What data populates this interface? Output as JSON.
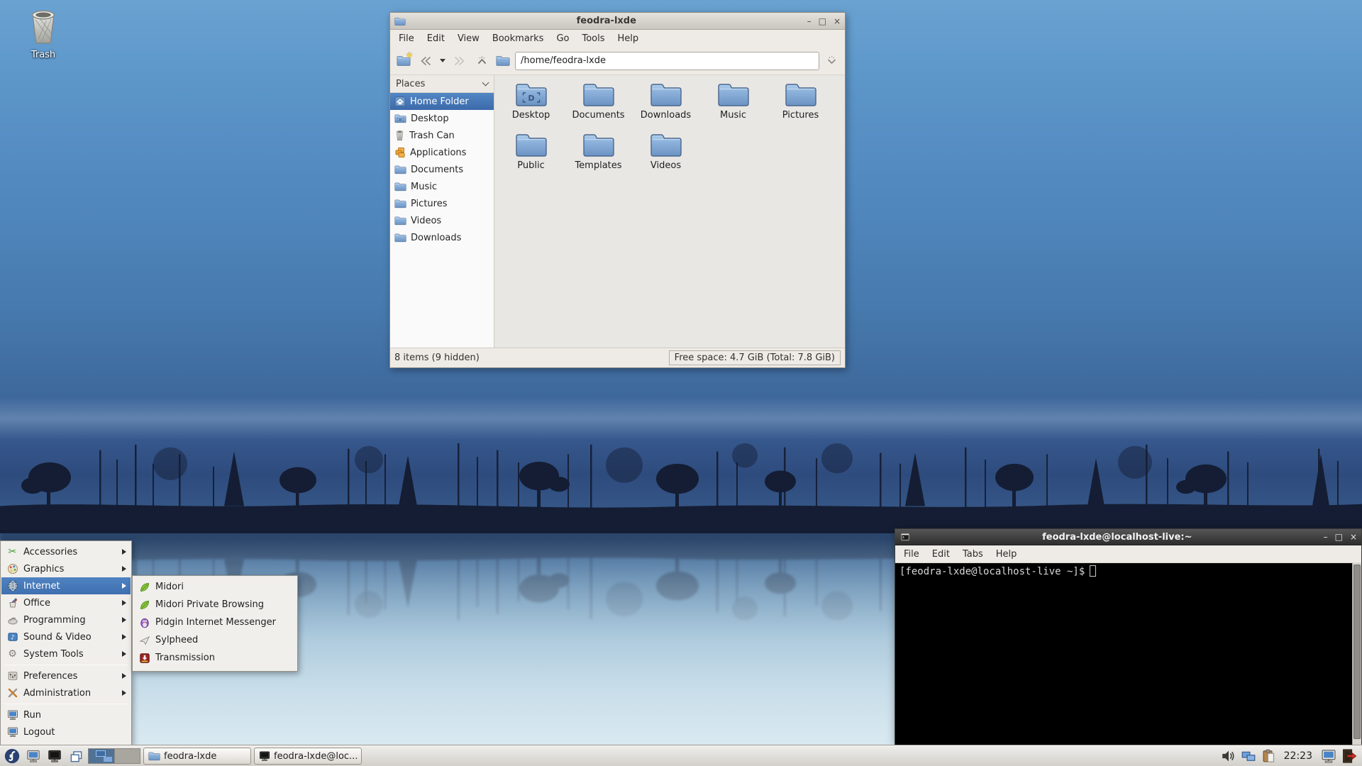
{
  "window_controls": {
    "minimize": "–",
    "maximize": "□",
    "close": "×"
  },
  "desktop": {
    "trash_label": "Trash"
  },
  "file_manager": {
    "title": "feodra-lxde",
    "menu_items": [
      "File",
      "Edit",
      "View",
      "Bookmarks",
      "Go",
      "Tools",
      "Help"
    ],
    "path": "/home/feodra-lxde",
    "places_header": "Places",
    "places": [
      {
        "label": "Home Folder",
        "icon": "home-icon",
        "selected": true
      },
      {
        "label": "Desktop",
        "icon": "desktop-folder-icon"
      },
      {
        "label": "Trash Can",
        "icon": "trash-icon"
      },
      {
        "label": "Applications",
        "icon": "applications-icon"
      },
      {
        "label": "Documents",
        "icon": "folder-icon"
      },
      {
        "label": "Music",
        "icon": "folder-icon"
      },
      {
        "label": "Pictures",
        "icon": "folder-icon"
      },
      {
        "label": "Videos",
        "icon": "folder-icon"
      },
      {
        "label": "Downloads",
        "icon": "folder-icon"
      }
    ],
    "folders": [
      {
        "label": "Desktop",
        "icon": "desktop-folder-icon"
      },
      {
        "label": "Documents",
        "icon": "folder-icon"
      },
      {
        "label": "Downloads",
        "icon": "folder-icon"
      },
      {
        "label": "Music",
        "icon": "folder-icon"
      },
      {
        "label": "Pictures",
        "icon": "folder-icon"
      },
      {
        "label": "Public",
        "icon": "folder-icon"
      },
      {
        "label": "Templates",
        "icon": "folder-icon"
      },
      {
        "label": "Videos",
        "icon": "folder-icon"
      }
    ],
    "status_left": "8 items (9 hidden)",
    "status_right": "Free space: 4.7 GiB (Total: 7.8 GiB)"
  },
  "terminal": {
    "title": "feodra-lxde@localhost-live:~",
    "menu_items": [
      "File",
      "Edit",
      "Tabs",
      "Help"
    ],
    "prompt": "[feodra-lxde@localhost-live ~]$"
  },
  "app_menu": {
    "items": [
      {
        "label": "Accessories",
        "icon": "accessories-icon",
        "has_submenu": true
      },
      {
        "label": "Graphics",
        "icon": "graphics-icon",
        "has_submenu": true
      },
      {
        "label": "Internet",
        "icon": "internet-icon",
        "has_submenu": true,
        "selected": true
      },
      {
        "label": "Office",
        "icon": "office-icon",
        "has_submenu": true
      },
      {
        "label": "Programming",
        "icon": "programming-icon",
        "has_submenu": true
      },
      {
        "label": "Sound & Video",
        "icon": "sound-video-icon",
        "has_submenu": true
      },
      {
        "label": "System Tools",
        "icon": "system-tools-icon",
        "has_submenu": true
      },
      {
        "label": "Preferences",
        "icon": "preferences-icon",
        "has_submenu": true
      },
      {
        "label": "Administration",
        "icon": "administration-icon",
        "has_submenu": true
      },
      {
        "label": "Run",
        "icon": "run-icon"
      },
      {
        "label": "Logout",
        "icon": "logout-icon"
      }
    ]
  },
  "internet_submenu": {
    "items": [
      {
        "label": "Midori",
        "icon": "midori-icon"
      },
      {
        "label": "Midori Private Browsing",
        "icon": "midori-icon"
      },
      {
        "label": "Pidgin Internet Messenger",
        "icon": "pidgin-icon"
      },
      {
        "label": "Sylpheed",
        "icon": "sylpheed-icon"
      },
      {
        "label": "Transmission",
        "icon": "transmission-icon"
      }
    ]
  },
  "taskbar": {
    "tasks": [
      {
        "label": "feodra-lxde",
        "icon": "folder-icon"
      },
      {
        "label": "feodra-lxde@loc...",
        "icon": "terminal-icon"
      }
    ],
    "clock": "22:23"
  },
  "colors": {
    "selection_blue": "#4477b8",
    "folder_blue": "#7ba3d4",
    "sky_blue": "#5189bf",
    "panel_gray": "#d8d5d0",
    "terminal_bg": "#000000"
  }
}
